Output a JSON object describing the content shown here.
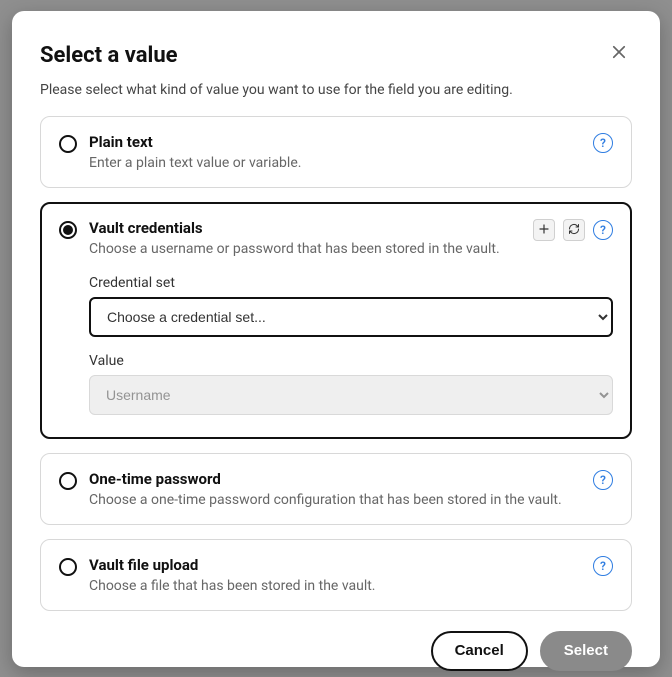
{
  "modal": {
    "title": "Select a value",
    "description": "Please select what kind of value you want to use for the field you are editing."
  },
  "options": {
    "plain_text": {
      "title": "Plain text",
      "description": "Enter a plain text value or variable."
    },
    "vault_credentials": {
      "title": "Vault credentials",
      "description": "Choose a username or password that has been stored in the vault.",
      "credential_set_label": "Credential set",
      "credential_set_placeholder": "Choose a credential set...",
      "value_label": "Value",
      "value_placeholder": "Username"
    },
    "otp": {
      "title": "One-time password",
      "description": "Choose a one-time password configuration that has been stored in the vault."
    },
    "file_upload": {
      "title": "Vault file upload",
      "description": "Choose a file that has been stored in the vault."
    }
  },
  "footer": {
    "cancel": "Cancel",
    "select": "Select"
  },
  "help_glyph": "?"
}
